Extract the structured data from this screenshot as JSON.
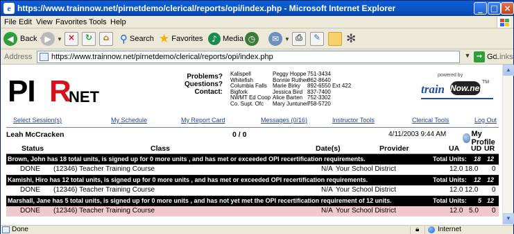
{
  "window": {
    "title": "https://www.trainnow.net/pirnetdemo/clerical/reports/opi/index.php - Microsoft Internet Explorer",
    "buttons": {
      "minimize": "_",
      "maximize": "□",
      "close": "×"
    }
  },
  "menu": [
    "File",
    "Edit",
    "View",
    "Favorites",
    "Tools",
    "Help"
  ],
  "toolbar": {
    "back": "Back",
    "search": "Search",
    "favorites": "Favorites",
    "media": "Media"
  },
  "address": {
    "label": "Address",
    "url": "https://www.trainnow.net/pirnetdemo/clerical/reports/opi/index.php",
    "go": "Go",
    "links": "Links"
  },
  "page": {
    "logo": {
      "pi": "PI",
      "r": "R",
      "net": "NET"
    },
    "contact_labels": [
      "Problems?",
      "Questions?",
      "Contact:"
    ],
    "contacts": {
      "places": [
        "Kalispell",
        "Whitefish",
        "Columbia Falls",
        "Bigfork",
        "NWMT Ed Coop",
        "Co. Supt. Ofc"
      ],
      "names": [
        "Peggy Hoppe",
        "Bonnie Ruther",
        "Marie Birky",
        "Jessica Bird",
        "Alice Barten",
        "Mary Juntunen"
      ],
      "phones": [
        "751-3434",
        "862-8640",
        "892-6550 Ext 422",
        "837-7400",
        "752-3302",
        "758-5720"
      ]
    },
    "powered_by": {
      "label": "powered by",
      "train": "train",
      "now": "Now",
      "net": ".net",
      "tm": "TM"
    },
    "nav": [
      "Select Session(s)",
      "My Schedule",
      "My Report Card",
      "Messages (0/16)",
      "Instructor Tools",
      "Clerical Tools",
      "Log Out"
    ],
    "user": {
      "name": "Leah McCracken",
      "count": "0 / 0",
      "datetime": "4/11/2003 9:44 AM",
      "profile": "My Profile"
    },
    "table": {
      "headers": [
        "Status",
        "Class",
        "Date(s)",
        "Provider",
        "UA",
        "UD",
        "UR"
      ],
      "groups": [
        {
          "summary": "Brown, John has 18 total units, is signed up for 0 more units , and has met or exceeded OPI recertification requirements.",
          "total_label": "Total Units:",
          "total_ud": "18",
          "total_ur": "12",
          "row": {
            "status": "DONE",
            "class": "(12346) Teacher Training Course",
            "dates": "N/A",
            "provider": "Your School District",
            "ua": "12.0",
            "ud": "18.0",
            "ur": "0"
          },
          "highlight": false
        },
        {
          "summary": "Kamishi, Hiro has 12 total units, is signed up for 0 more units , and has met or exceeded OPI recertification requirements.",
          "total_label": "Total Units:",
          "total_ud": "12",
          "total_ur": "12",
          "row": {
            "status": "DONE",
            "class": "(12346) Teacher Training Course",
            "dates": "N/A",
            "provider": "Your School District",
            "ua": "12.0",
            "ud": "12.0",
            "ur": "0"
          },
          "highlight": false
        },
        {
          "summary": "Marshall, Jane has 5 total units, is signed up for 0 more units , and has not yet met the OPI recertification requirement of 12 units.",
          "total_label": "Total Units:",
          "total_ud": "5",
          "total_ur": "12",
          "row": {
            "status": "DONE",
            "class": "(12346) Teacher Training Course",
            "dates": "N/A",
            "provider": "Your School District",
            "ua": "12.0",
            "ud": "5.0",
            "ur": "0"
          },
          "highlight": true
        }
      ]
    }
  },
  "status": {
    "text": "Done",
    "zone": "Internet"
  },
  "colors": {
    "title_bar": "#0b53c4",
    "logo_red": "#d3131b",
    "link": "#1f3fa0",
    "highlight_row": "#f2c8c8"
  }
}
